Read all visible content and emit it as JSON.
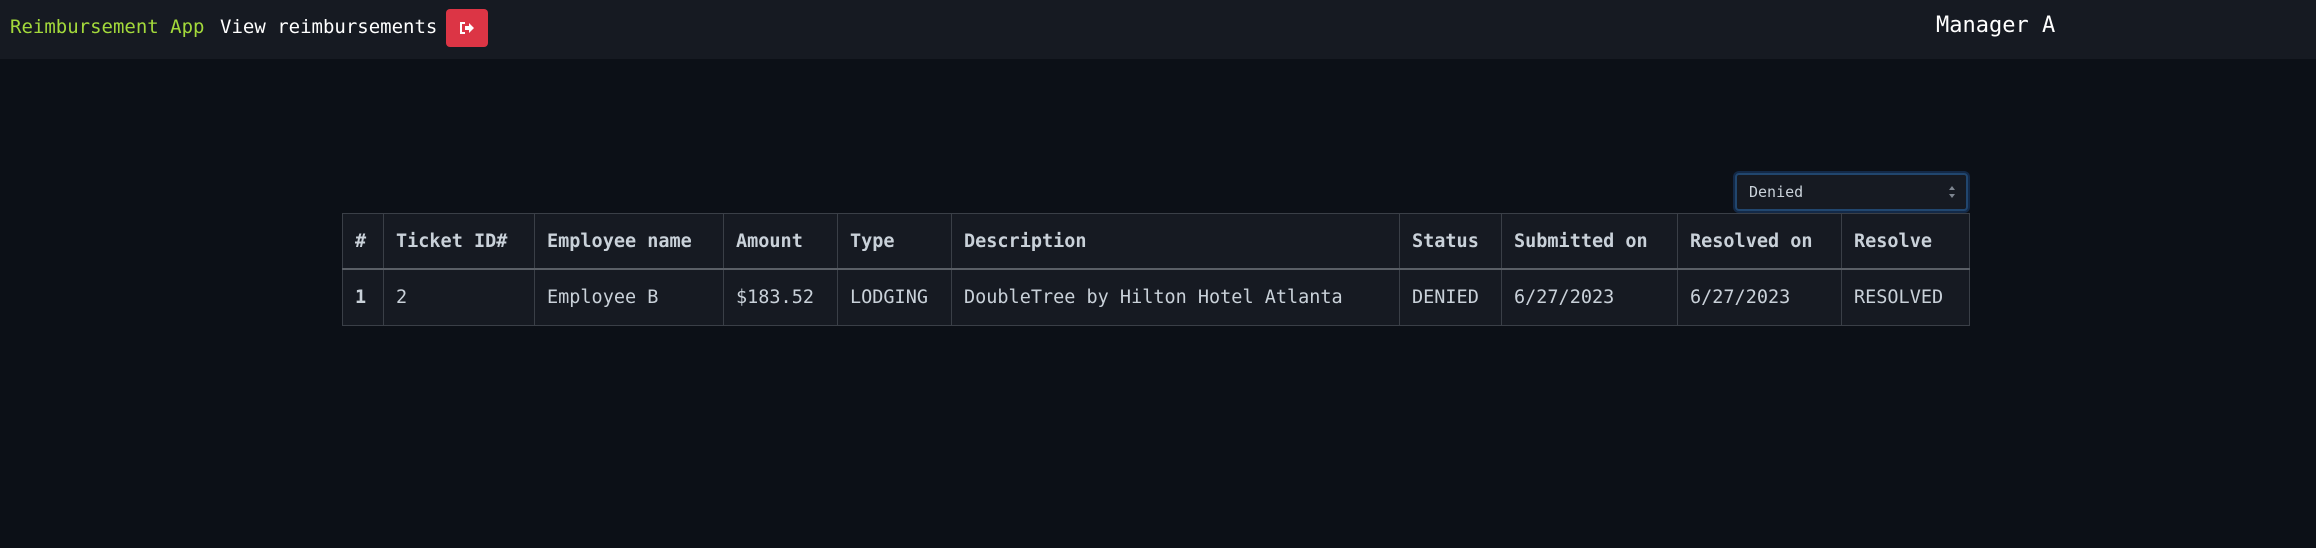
{
  "navbar": {
    "brand": "Reimbursement App",
    "view_link": "View reimbursements",
    "logout_icon": "sign-out-icon",
    "username": "Manager A"
  },
  "filter": {
    "selected": "Denied",
    "icon": "select-arrows-icon"
  },
  "table": {
    "headers": [
      "#",
      "Ticket ID#",
      "Employee name",
      "Amount",
      "Type",
      "Description",
      "Status",
      "Submitted on",
      "Resolved on",
      "Resolve"
    ],
    "rows": [
      {
        "num": "1",
        "ticket_id": "2",
        "employee": "Employee B",
        "amount": "$183.52",
        "type": "LODGING",
        "description": "DoubleTree by Hilton Hotel Atlanta",
        "status": "DENIED",
        "submitted": "6/27/2023",
        "resolved": "6/27/2023",
        "resolve": "RESOLVED"
      }
    ]
  },
  "colors": {
    "background": "#0c1017",
    "navbar": "#161a22",
    "brand": "#a3d93b",
    "logout_button": "#dc3545"
  }
}
